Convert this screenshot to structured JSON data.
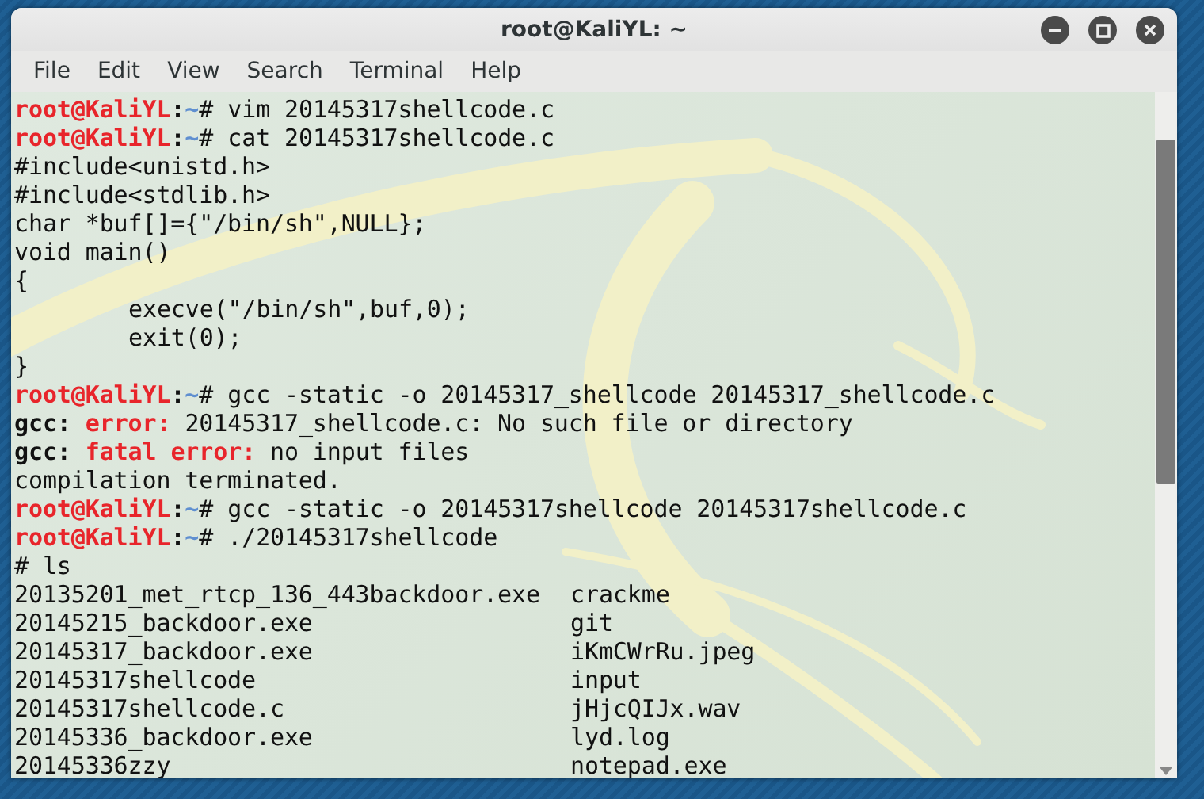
{
  "window": {
    "title": "root@KaliYL: ~"
  },
  "menu": [
    "File",
    "Edit",
    "View",
    "Search",
    "Terminal",
    "Help"
  ],
  "lines": [
    {
      "kind": "prompt",
      "host": "root@KaliYL",
      "sep": ":",
      "path": "~",
      "symbol": "#",
      "command": "vim 20145317shellcode.c"
    },
    {
      "kind": "prompt",
      "host": "root@KaliYL",
      "sep": ":",
      "path": "~",
      "symbol": "#",
      "command": "cat 20145317shellcode.c"
    },
    {
      "kind": "text",
      "indented": false,
      "text": "#include<unistd.h>"
    },
    {
      "kind": "text",
      "indented": false,
      "text": "#include<stdlib.h>"
    },
    {
      "kind": "text",
      "indented": false,
      "text": "char *buf[]={\"/bin/sh\",NULL};"
    },
    {
      "kind": "text",
      "indented": false,
      "text": "void main()"
    },
    {
      "kind": "text",
      "indented": false,
      "text": "{"
    },
    {
      "kind": "text",
      "indented": true,
      "text": "execve(\"/bin/sh\",buf,0);"
    },
    {
      "kind": "text",
      "indented": true,
      "text": "exit(0);"
    },
    {
      "kind": "text",
      "indented": false,
      "text": "}"
    },
    {
      "kind": "prompt",
      "host": "root@KaliYL",
      "sep": ":",
      "path": "~",
      "symbol": "#",
      "command": "gcc -static -o 20145317_shellcode 20145317_shellcode.c"
    },
    {
      "kind": "error",
      "program": "gcc:",
      "level": "error:",
      "message": "20145317_shellcode.c: No such file or directory"
    },
    {
      "kind": "error",
      "program": "gcc:",
      "level": "fatal error:",
      "message": "no input files"
    },
    {
      "kind": "text",
      "indented": false,
      "text": "compilation terminated."
    },
    {
      "kind": "prompt",
      "host": "root@KaliYL",
      "sep": ":",
      "path": "~",
      "symbol": "#",
      "command": "gcc -static -o 20145317shellcode 20145317shellcode.c"
    },
    {
      "kind": "prompt",
      "host": "root@KaliYL",
      "sep": ":",
      "path": "~",
      "symbol": "#",
      "command": "./20145317shellcode"
    },
    {
      "kind": "text",
      "indented": false,
      "text": "# ls"
    },
    {
      "kind": "columns",
      "left": "20135201_met_rtcp_136_443backdoor.exe",
      "right": "crackme"
    },
    {
      "kind": "columns",
      "left": "20145215_backdoor.exe",
      "right": "git"
    },
    {
      "kind": "columns",
      "left": "20145317_backdoor.exe",
      "right": "iKmCWrRu.jpeg"
    },
    {
      "kind": "columns",
      "left": "20145317shellcode",
      "right": "input"
    },
    {
      "kind": "columns",
      "left": "20145317shellcode.c",
      "right": "jHjcQIJx.wav"
    },
    {
      "kind": "columns",
      "left": "20145336_backdoor.exe",
      "right": "lyd.log"
    },
    {
      "kind": "columns",
      "left": "20145336zzy",
      "right": "notepad.exe"
    }
  ]
}
